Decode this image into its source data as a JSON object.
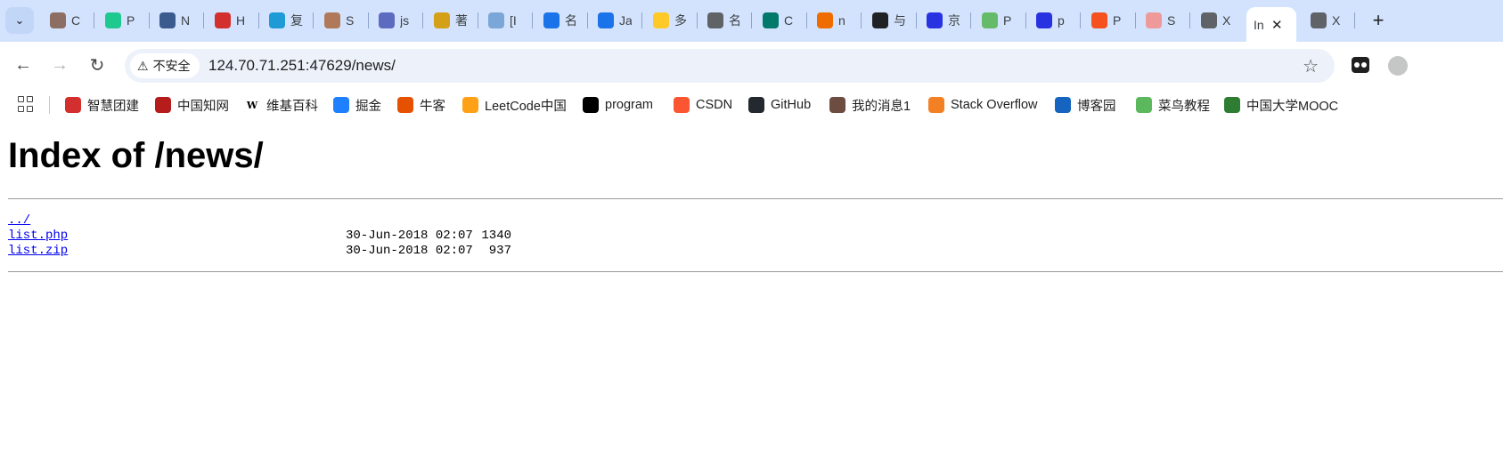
{
  "browser": {
    "tabs": [
      {
        "title": "C",
        "icon": "avatar-girl-icon",
        "color": "#8d6e63"
      },
      {
        "title": "P",
        "icon": "linkedin-style-icon",
        "color": "#1ec98f"
      },
      {
        "title": "N",
        "icon": "n-circle-icon",
        "color": "#3b5b8f"
      },
      {
        "title": "H",
        "icon": "bird-icon",
        "color": "#d32f2f"
      },
      {
        "title": "复",
        "icon": "bilibili-tv-icon",
        "color": "#1e9bd7"
      },
      {
        "title": "S",
        "icon": "bag-icon",
        "color": "#b07a5a"
      },
      {
        "title": "js",
        "icon": "bird-blue-icon",
        "color": "#5c6bc0"
      },
      {
        "title": "著",
        "icon": "trophy-icon",
        "color": "#d4a017"
      },
      {
        "title": "[I",
        "icon": "globe-hand-icon",
        "color": "#7aa7d8"
      },
      {
        "title": "名",
        "icon": "b-square-icon",
        "color": "#1a73e8"
      },
      {
        "title": "Ja",
        "icon": "b-square-icon",
        "color": "#1a73e8"
      },
      {
        "title": "多",
        "icon": "slash-square-icon",
        "color": "#ffca28"
      },
      {
        "title": "名",
        "icon": "globe-icon",
        "color": "#5f6368"
      },
      {
        "title": "C",
        "icon": "eye-circle-icon",
        "color": "#00796b"
      },
      {
        "title": "n",
        "icon": "c-orange-icon",
        "color": "#ef6c00"
      },
      {
        "title": "与",
        "icon": "openai-icon",
        "color": "#202124"
      },
      {
        "title": "京",
        "icon": "paw-icon",
        "color": "#2932e1"
      },
      {
        "title": "P",
        "icon": "code-bubble-icon",
        "color": "#66bb6a"
      },
      {
        "title": "p",
        "icon": "paw-icon",
        "color": "#2932e1"
      },
      {
        "title": "P",
        "icon": "c-red-icon",
        "color": "#f4511e"
      },
      {
        "title": "S",
        "icon": "cloud-icon",
        "color": "#ef9a9a"
      },
      {
        "title": "X",
        "icon": "globe-icon",
        "color": "#5f6368"
      },
      {
        "title": "In",
        "icon": "none",
        "color": "#ffffff",
        "active": true
      },
      {
        "title": "X",
        "icon": "globe-icon",
        "color": "#5f6368"
      }
    ],
    "new_tab": "+",
    "security_label": "不安全",
    "url": "124.70.71.251:47629/news/",
    "bookmarks": [
      {
        "label": "智慧团建",
        "icon": "youth-league-icon",
        "color": "#d32f2f"
      },
      {
        "label": "中国知网",
        "icon": "cnki-icon",
        "color": "#b71c1c"
      },
      {
        "label": "维基百科",
        "icon": "wikipedia-icon",
        "color": "#ffffff"
      },
      {
        "label": "掘金",
        "icon": "juejin-icon",
        "color": "#1e80ff"
      },
      {
        "label": "牛客",
        "icon": "nowcoder-icon",
        "color": "#e65100"
      },
      {
        "label": "LeetCode中国",
        "icon": "leetcode-icon",
        "color": "#ffa116"
      },
      {
        "label": "program",
        "icon": "pbd-icon",
        "color": "#000000"
      },
      {
        "label": "CSDN",
        "icon": "csdn-icon",
        "color": "#fc5531"
      },
      {
        "label": "GitHub",
        "icon": "github-icon",
        "color": "#24292f"
      },
      {
        "label": "我的消息1",
        "icon": "avatar-icon",
        "color": "#6d4c41"
      },
      {
        "label": "Stack Overflow",
        "icon": "stackoverflow-icon",
        "color": "#f48024"
      },
      {
        "label": "博客园",
        "icon": "cnblogs-icon",
        "color": "#1565c0"
      },
      {
        "label": "菜鸟教程",
        "icon": "runoob-icon",
        "color": "#5cb85c"
      },
      {
        "label": "中国大学MOOC",
        "icon": "mooc-icon",
        "color": "#2e7d32"
      }
    ]
  },
  "page": {
    "title": "Index of /news/",
    "entries": [
      {
        "name": "../",
        "date": "",
        "size": ""
      },
      {
        "name": "list.php",
        "date": "30-Jun-2018 02:07",
        "size": "1340"
      },
      {
        "name": "list.zip",
        "date": "30-Jun-2018 02:07",
        "size": "937"
      }
    ]
  }
}
